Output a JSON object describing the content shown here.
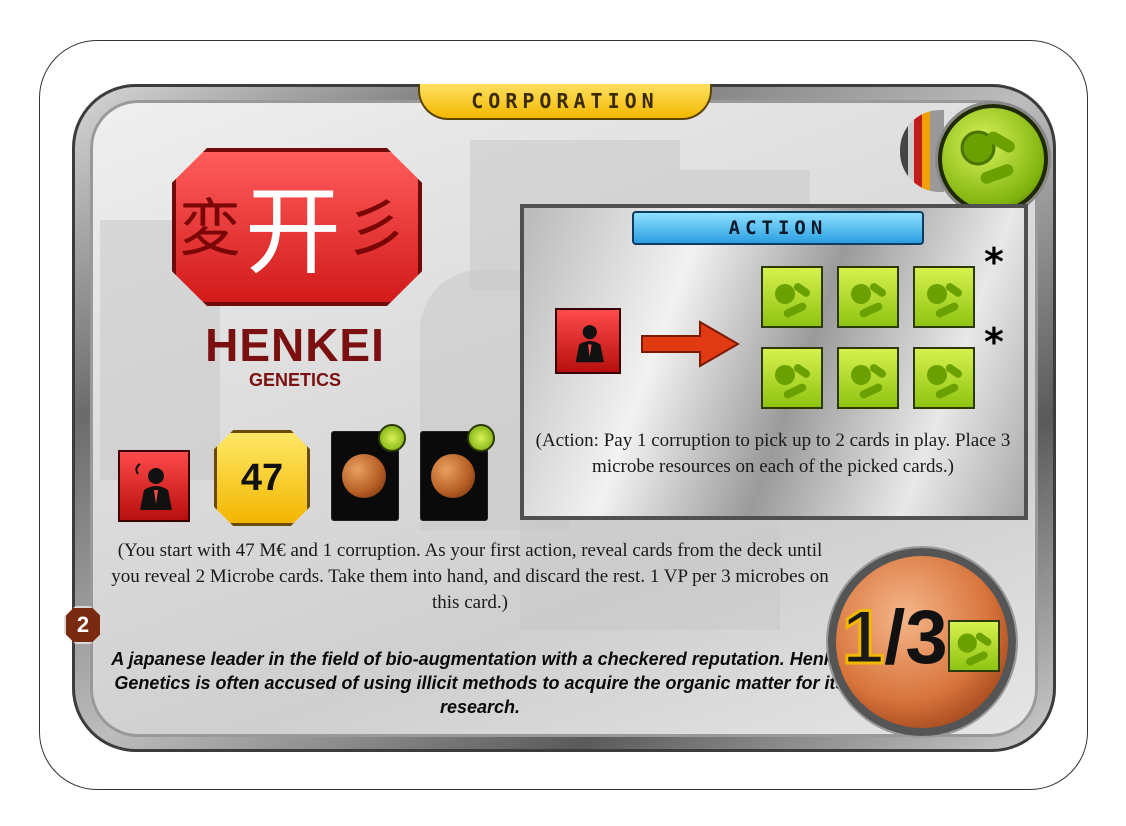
{
  "card": {
    "type_label": "CORPORATION",
    "corp_name": "HENKEI",
    "corp_subtitle": "GENETICS",
    "logo_glyphs": [
      "変",
      "开",
      "彡"
    ],
    "tag": "microbe-tag-icon",
    "starting_megacredits": "47",
    "action": {
      "label": "ACTION",
      "asterisks": [
        "*",
        "*"
      ],
      "description": "(Action: Pay 1 corruption to pick up to 2 cards in play. Place 3 microbe resources on each of the picked cards.)"
    },
    "start_description": "(You start with 47 M€ and 1 corruption. As your first action, reveal cards from the deck until you reveal 2 Microbe cards. Take them into hand, and discard the rest. 1 VP per 3 microbes on this card.)",
    "flavor_text": "A japanese leader in the field of bio-augmentation with a checkered reputation. Henkei Genetics is often accused of using illicit methods to acquire the organic matter for its research.",
    "expansion_badge": "2",
    "vp": {
      "numerator": "1",
      "separator": "/3"
    }
  },
  "colors": {
    "corporation_gold": "#f3b800",
    "action_blue": "#2a9ee0",
    "corruption_red": "#d21a1a",
    "microbe_green": "#8fc411",
    "name_red": "#7a1010"
  },
  "icons": [
    "microbe-tag-icon",
    "corruption-icon",
    "megacredit-icon",
    "microbe-card-icon",
    "arrow-icon",
    "microbe-resource-icon",
    "expansion-badge-icon",
    "vp-disc-icon"
  ]
}
